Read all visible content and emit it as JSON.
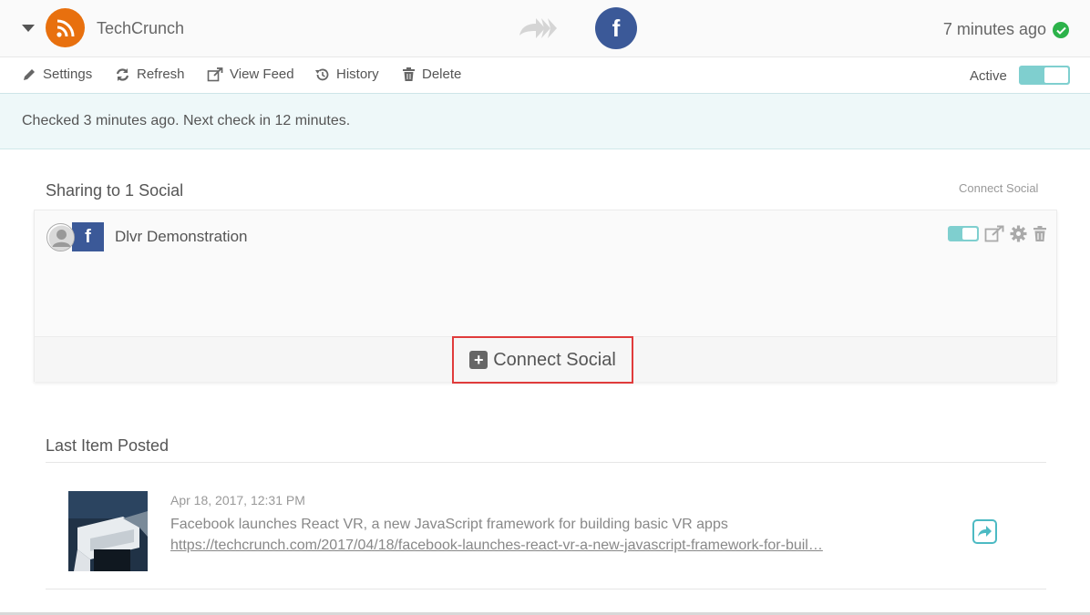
{
  "header": {
    "feed_name": "TechCrunch",
    "destination_letter": "f",
    "time_ago": "7 minutes ago",
    "status_color": "#2cb24a",
    "feed_icon_color": "#e8700e",
    "facebook_color": "#3b5998"
  },
  "toolbar": {
    "settings_label": "Settings",
    "refresh_label": "Refresh",
    "view_feed_label": "View Feed",
    "history_label": "History",
    "delete_label": "Delete",
    "active_label": "Active",
    "active_on": true
  },
  "status": {
    "message": "Checked 3 minutes ago. Next check in 12 minutes."
  },
  "sharing": {
    "title": "Sharing to 1 Social",
    "connect_link_label": "Connect Social",
    "accounts": [
      {
        "name": "Dlvr Demonstration",
        "network_letter": "f",
        "enabled": true
      }
    ],
    "connect_button_label": "Connect Social",
    "connect_button_plus": "+"
  },
  "last_item": {
    "title": "Last Item Posted",
    "date": "Apr 18, 2017, 12:31 PM",
    "headline": "Facebook launches React VR, a new JavaScript framework for building basic VR apps",
    "url": "https://techcrunch.com/2017/04/18/facebook-launches-react-vr-a-new-javascript-framework-for-buil…"
  }
}
